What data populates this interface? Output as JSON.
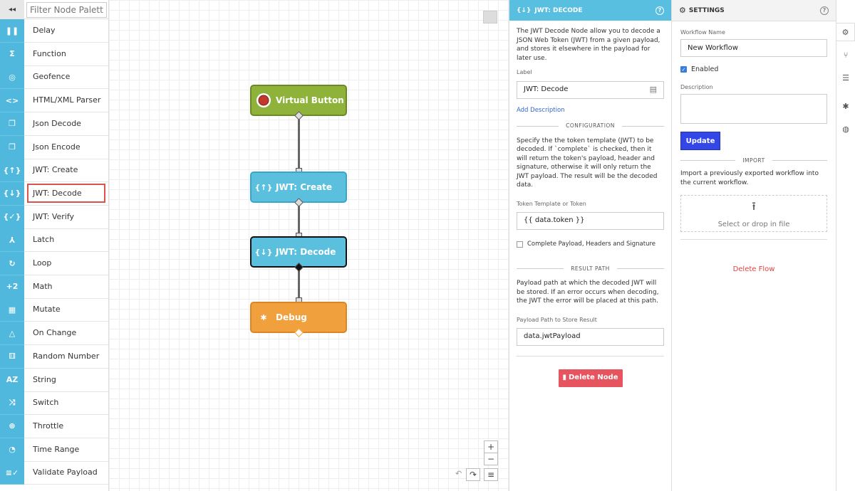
{
  "palette": {
    "collapse_icon": "◂◂",
    "filter_placeholder": "Filter Node Palette",
    "items": [
      {
        "label": "Delay",
        "icon": "pause-icon",
        "glyph": "❚❚"
      },
      {
        "label": "Function",
        "icon": "sigma-icon",
        "glyph": "Σ"
      },
      {
        "label": "Geofence",
        "icon": "target-icon",
        "glyph": "◎"
      },
      {
        "label": "HTML/XML Parser",
        "icon": "code-icon",
        "glyph": "<>"
      },
      {
        "label": "Json Decode",
        "icon": "copy-icon",
        "glyph": "❐"
      },
      {
        "label": "Json Encode",
        "icon": "copy-icon",
        "glyph": "❐"
      },
      {
        "label": "JWT: Create",
        "icon": "jwt-icon",
        "glyph": "{↑}"
      },
      {
        "label": "JWT: Decode",
        "icon": "jwt-icon",
        "glyph": "{↓}"
      },
      {
        "label": "JWT: Verify",
        "icon": "jwt-icon",
        "glyph": "{✓}"
      },
      {
        "label": "Latch",
        "icon": "latch-icon",
        "glyph": "⅄"
      },
      {
        "label": "Loop",
        "icon": "loop-icon",
        "glyph": "↻"
      },
      {
        "label": "Math",
        "icon": "math-icon",
        "glyph": "+2"
      },
      {
        "label": "Mutate",
        "icon": "grid-icon",
        "glyph": "▦"
      },
      {
        "label": "On Change",
        "icon": "delta-icon",
        "glyph": "△"
      },
      {
        "label": "Random Number",
        "icon": "dice-icon",
        "glyph": "⚅"
      },
      {
        "label": "String",
        "icon": "az-icon",
        "glyph": "AZ"
      },
      {
        "label": "Switch",
        "icon": "shuffle-icon",
        "glyph": "⤨"
      },
      {
        "label": "Throttle",
        "icon": "throttle-icon",
        "glyph": "⊕"
      },
      {
        "label": "Time Range",
        "icon": "clock-icon",
        "glyph": "◔"
      },
      {
        "label": "Validate Payload",
        "icon": "validate-icon",
        "glyph": "≡✓"
      }
    ],
    "selected_index": 7
  },
  "canvas": {
    "nodes": [
      {
        "label": "Virtual Button",
        "color": "#8fb23a",
        "border": "#6c8a24"
      },
      {
        "label": "JWT: Create",
        "color": "#5bc0de",
        "border": "#3aa7c8"
      },
      {
        "label": "JWT: Decode",
        "color": "#5bc0de",
        "border": "#111111"
      },
      {
        "label": "Debug",
        "color": "#f0a03c",
        "border": "#d9862a"
      }
    ],
    "zoom_in": "+",
    "zoom_out": "−",
    "undo": "↶",
    "redo": "↷",
    "menu": "≡"
  },
  "editor": {
    "title": "JWT: DECODE",
    "help": "?",
    "intro": "The JWT Decode Node allow you to decode a JSON Web Token (JWT) from a given payload, and stores it elsewhere in the payload for later use.",
    "label_caption": "Label",
    "label_value": "JWT: Decode",
    "add_description": "Add Description",
    "configuration_heading": "CONFIGURATION",
    "config_text": "Specify the the token template (JWT) to be decoded. If `complete` is checked, then it will return the token's payload, header and signature, otherwise it will only return the JWT payload. The result will be the decoded data.",
    "token_caption": "Token Template or Token",
    "token_value": "{{ data.token }}",
    "complete_label": "Complete Payload, Headers and Signature",
    "result_heading": "RESULT PATH",
    "result_text": "Payload path at which the decoded JWT will be stored. If an error occurs when decoding, the JWT the error will be placed at this path.",
    "path_caption": "Payload Path to Store Result",
    "path_value": "data.jwtPayload",
    "delete_label": "Delete Node"
  },
  "settings": {
    "title": "SETTINGS",
    "help": "?",
    "workflow_name_caption": "Workflow Name",
    "workflow_name_value": "New Workflow",
    "enabled_label": "Enabled",
    "description_caption": "Description",
    "update_label": "Update",
    "import_heading": "IMPORT",
    "import_text": "Import a previously exported workflow into the current workflow.",
    "drop_label": "Select or drop in file",
    "delete_flow_label": "Delete Flow"
  },
  "rail": {
    "items": [
      "gear-icon",
      "branch-icon",
      "database-icon",
      "bug-icon",
      "globe-icon"
    ],
    "glyphs": [
      "⚙",
      "⑂",
      "☰",
      "✱",
      "◍"
    ]
  }
}
